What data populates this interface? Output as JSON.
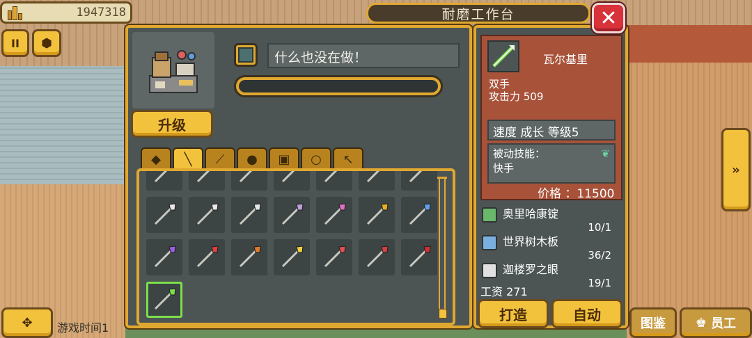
{
  "hud": {
    "money": "1947318",
    "game_time_label": "游戏时间1"
  },
  "window": {
    "title": "耐磨工作台",
    "close_label": "✕"
  },
  "workbench": {
    "status_text": "什么也没在做！",
    "progress": 0,
    "upgrade_label": "升级"
  },
  "tabs": [
    {
      "name": "shield",
      "glyph": "◆"
    },
    {
      "name": "spear",
      "glyph": "╲"
    },
    {
      "name": "staff",
      "glyph": "⟋"
    },
    {
      "name": "helmet",
      "glyph": "●"
    },
    {
      "name": "armor",
      "glyph": "▣"
    },
    {
      "name": "ring",
      "glyph": "○"
    },
    {
      "name": "tool",
      "glyph": "↖"
    }
  ],
  "active_tab": 1,
  "items": [
    {
      "icon": "spear-icon",
      "color": "#4ab86a"
    },
    {
      "icon": "spear-icon",
      "color": "#f0f0e0"
    },
    {
      "icon": "spear-icon",
      "color": "#e8c040"
    },
    {
      "icon": "spear-icon",
      "color": "#c85a8a"
    },
    {
      "icon": "spear-icon",
      "color": "#4a8ae0"
    },
    {
      "icon": "spear-icon",
      "color": "#7ac040"
    },
    {
      "icon": "spear-icon",
      "color": "#b07ae0"
    },
    {
      "icon": "spear-icon",
      "color": "#e8e8e8"
    },
    {
      "icon": "spear-icon",
      "color": "#e8e8e8"
    },
    {
      "icon": "spear-icon",
      "color": "#e8e8e8"
    },
    {
      "icon": "spear-icon",
      "color": "#c0a0e0"
    },
    {
      "icon": "spear-icon",
      "color": "#e070c0"
    },
    {
      "icon": "spear-icon",
      "color": "#e8b020"
    },
    {
      "icon": "spear-icon",
      "color": "#60a0f0"
    },
    {
      "icon": "spear-icon",
      "color": "#9a60e0"
    },
    {
      "icon": "spear-icon",
      "color": "#e04040"
    },
    {
      "icon": "spear-icon",
      "color": "#e07a30"
    },
    {
      "icon": "spear-icon",
      "color": "#f0d040"
    },
    {
      "icon": "spear-icon",
      "color": "#e05050"
    },
    {
      "icon": "spear-icon",
      "color": "#d84040"
    },
    {
      "icon": "spear-icon",
      "color": "#d03030"
    },
    {
      "icon": "spear-icon",
      "color": "#7ce04a"
    }
  ],
  "selected_item": 21,
  "detail": {
    "name": "瓦尔基里",
    "type": "双手",
    "attack": "攻击力 509",
    "stats": "速度 成长 等级5",
    "passive_title": "被动技能：",
    "passive_value": "快手",
    "price": "价格 ：11500"
  },
  "materials": [
    {
      "name": "奥里哈康锭",
      "count": "10/1",
      "color": "#6ab86a"
    },
    {
      "name": "世界树木板",
      "count": "36/2",
      "color": "#7ab0e0"
    },
    {
      "name": "迦楼罗之眼",
      "count": "19/1",
      "color": "#e0e0e0"
    }
  ],
  "wage": "工资 271",
  "actions": {
    "craft": "打造",
    "auto": "自动"
  },
  "bottom_bar": {
    "catalog": "图鉴",
    "staff": "员工"
  }
}
